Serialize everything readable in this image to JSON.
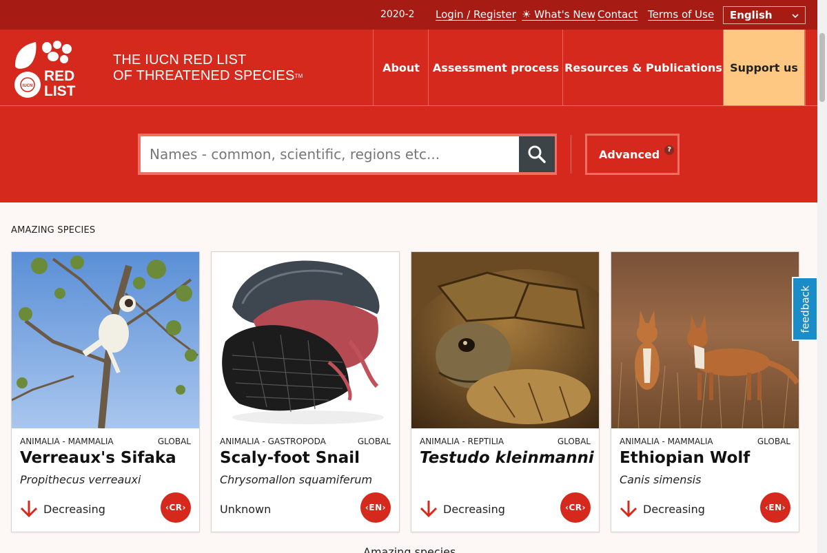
{
  "topbar": {
    "version": "2020-2",
    "login": "Login / Register",
    "whats_new": "☀ What's New",
    "contact": "Contact",
    "terms": "Terms of Use",
    "language": "English"
  },
  "header": {
    "brand_line1": "THE IUCN RED LIST",
    "brand_line2": "OF THREATENED SPECIES",
    "brand_tm": "TM",
    "logo_text_top": "RED",
    "logo_text_bottom": "LIST",
    "logo_iucn": "IUCN",
    "nav": [
      {
        "label": "About"
      },
      {
        "label": "Assessment process"
      },
      {
        "label": "Resources & Publications"
      },
      {
        "label": "Support us"
      }
    ]
  },
  "search": {
    "placeholder": "Names - common, scientific, regions etc...",
    "advanced_label": "Advanced",
    "help_glyph": "?"
  },
  "section": {
    "title": "AMAZING SPECIES",
    "more_text": "Amazing species"
  },
  "cards": [
    {
      "taxon": "ANIMALIA - MAMMALIA",
      "scope": "GLOBAL",
      "common": "Verreaux's Sifaka",
      "scientific": "Propithecus verreauxi",
      "trend": "Decreasing",
      "category": "CR"
    },
    {
      "taxon": "ANIMALIA - GASTROPODA",
      "scope": "GLOBAL",
      "common": "Scaly-foot Snail",
      "scientific": "Chrysomallon squamiferum",
      "trend": "Unknown",
      "category": "EN"
    },
    {
      "taxon": "ANIMALIA - REPTILIA",
      "scope": "GLOBAL",
      "common": "Testudo kleinmanni",
      "scientific": "",
      "trend": "Decreasing",
      "category": "CR"
    },
    {
      "taxon": "ANIMALIA - MAMMALIA",
      "scope": "GLOBAL",
      "common": "Ethiopian Wolf",
      "scientific": "Canis simensis",
      "trend": "Decreasing",
      "category": "EN"
    }
  ],
  "feedback": {
    "label": "feedback"
  },
  "colors": {
    "brand_red": "#d4291c",
    "dark_red": "#a61b13",
    "support_bg": "#ffc882",
    "feedback_blue": "#1a8cc8"
  },
  "icons": {
    "search": "search-icon",
    "trend_down": "arrow-down-icon",
    "chevron": "chevron-down-icon"
  }
}
